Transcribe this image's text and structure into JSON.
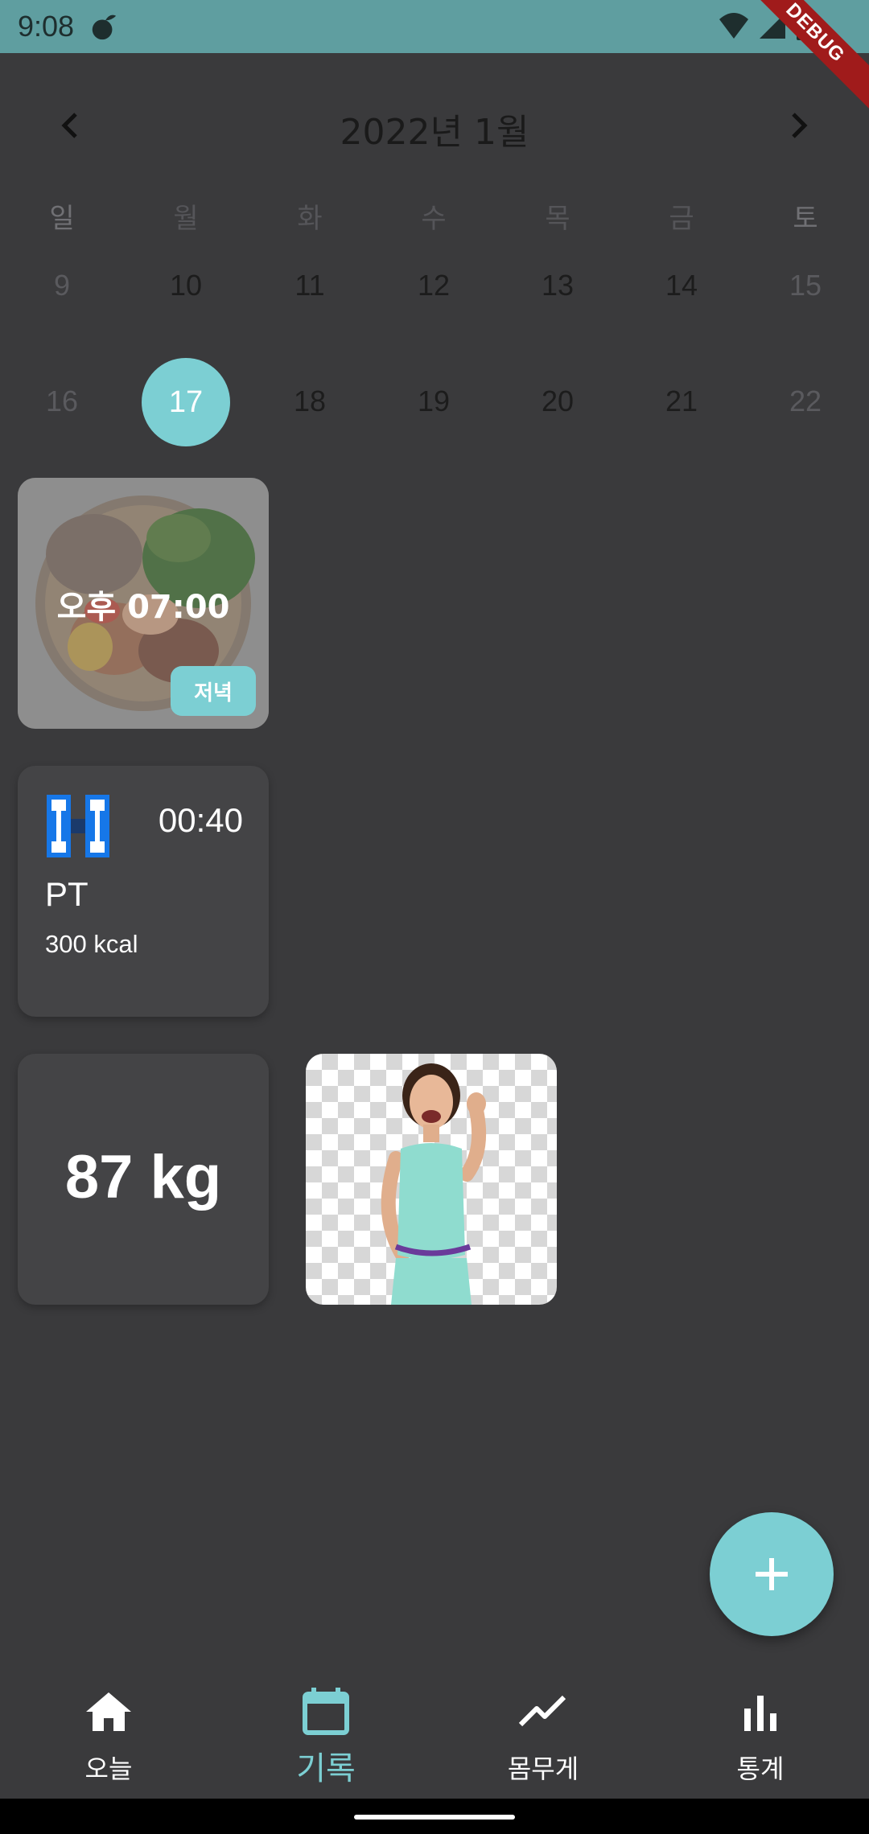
{
  "status_bar": {
    "time": "9:08",
    "debug_label": "DEBUG"
  },
  "calendar": {
    "title": "2022년 1월",
    "weekdays": [
      "일",
      "월",
      "화",
      "수",
      "목",
      "금",
      "토"
    ],
    "weeks": [
      [
        "9",
        "10",
        "11",
        "12",
        "13",
        "14",
        "15"
      ],
      [
        "16",
        "17",
        "18",
        "19",
        "20",
        "21",
        "22"
      ]
    ],
    "selected_day": "17"
  },
  "meal_card": {
    "time": "오후 07:00",
    "tag": "저녁"
  },
  "exercise_card": {
    "duration": "00:40",
    "name": "PT",
    "kcal": "300 kcal"
  },
  "weight_card": {
    "value": "87 kg"
  },
  "fab": {
    "icon": "plus-icon"
  },
  "bottom_nav": {
    "items": [
      {
        "label": "오늘",
        "icon": "home-icon"
      },
      {
        "label": "기록",
        "icon": "calendar-icon",
        "active": true
      },
      {
        "label": "몸무게",
        "icon": "trend-icon"
      },
      {
        "label": "통계",
        "icon": "bar-chart-icon"
      }
    ]
  },
  "colors": {
    "accent": "#7ccfd3",
    "background": "#3a3a3c",
    "status_bar": "#5f9ea0",
    "card": "#444446"
  }
}
